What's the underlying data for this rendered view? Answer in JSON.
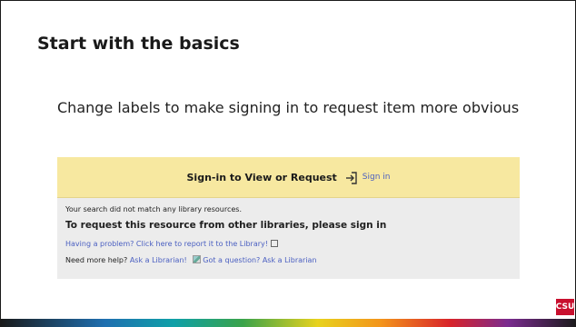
{
  "slide": {
    "title": "Start with the basics",
    "subtitle": "Change labels to make signing in to request item more obvious"
  },
  "panel": {
    "banner_title": "Sign-in to View or Request",
    "signin_link": "Sign in",
    "no_match": "Your search did not match any library resources.",
    "request_heading": "To request this resource from other libraries, please sign in",
    "problem_link": "Having a problem? Click here to report it to the Library!",
    "help_prefix": "Need more help?",
    "ask_link": "Ask a Librarian!",
    "image_alt": "Got a question? Ask a Librarian"
  },
  "logo": {
    "text": "CSU"
  },
  "colors": {
    "banner": "#f7e8a0",
    "link": "#4a5fc1",
    "logo": "#c8102e"
  }
}
